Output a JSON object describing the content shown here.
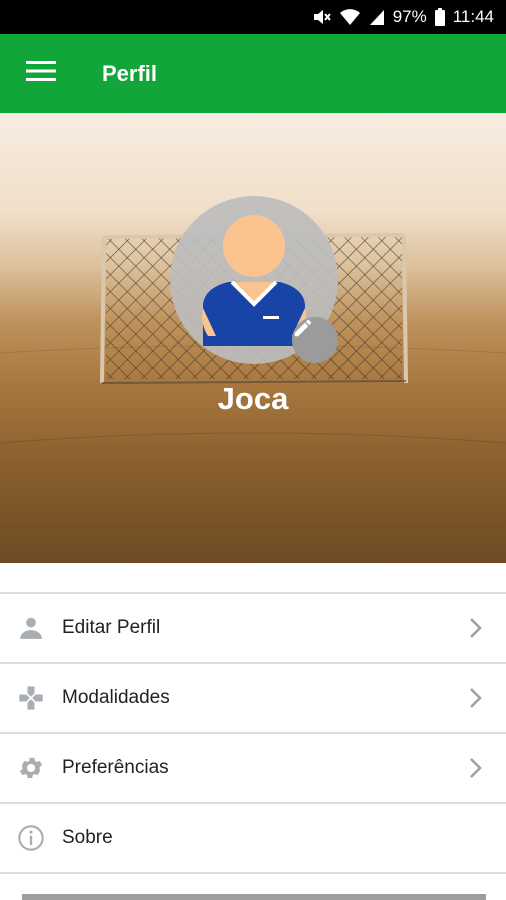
{
  "status_bar": {
    "battery": "97%",
    "time": "11:44",
    "icons": [
      "mute-icon",
      "wifi-icon",
      "signal-icon",
      "battery-icon"
    ]
  },
  "app_bar": {
    "title": "Perfil",
    "menu_icon": "hamburger-menu-icon",
    "color": "#12a53a"
  },
  "profile": {
    "name": "Joca",
    "edit_icon": "pencil-icon"
  },
  "menu": {
    "items": [
      {
        "label": "Editar Perfil",
        "icon": "person-icon",
        "chevron": true
      },
      {
        "label": "Modalidades",
        "icon": "gamepad-icon",
        "chevron": true
      },
      {
        "label": "Preferências",
        "icon": "gear-icon",
        "chevron": true
      },
      {
        "label": "Sobre",
        "icon": "info-icon",
        "chevron": false
      }
    ]
  }
}
